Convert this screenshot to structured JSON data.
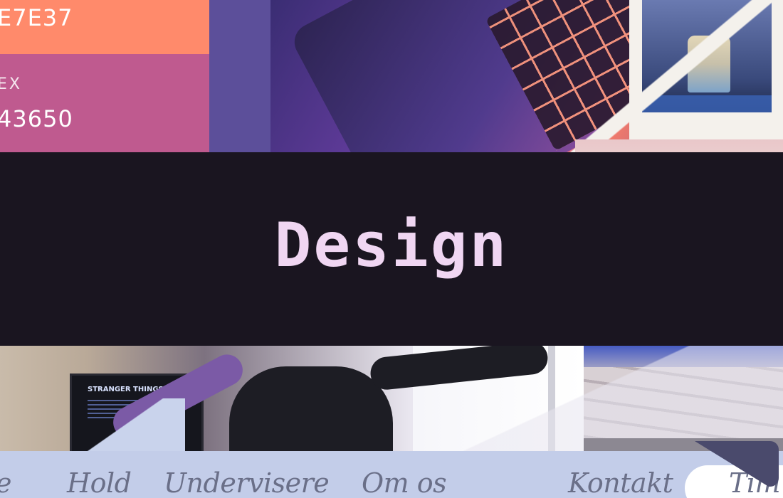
{
  "swatches": {
    "orange": {
      "code": "E7E37",
      "color": "#ff8a6b"
    },
    "pink": {
      "label": "EX",
      "code": "43650",
      "color": "#bf5a8f"
    }
  },
  "banner": {
    "title": "Design",
    "text_color": "#f0d6f2",
    "background": "#1a1520"
  },
  "tv": {
    "title": "STRANGER THINGS"
  },
  "nav": {
    "items": [
      "ne",
      "Hold",
      "Undervisere",
      "Om os",
      "Kontakt"
    ],
    "pill_text": "Tim"
  }
}
